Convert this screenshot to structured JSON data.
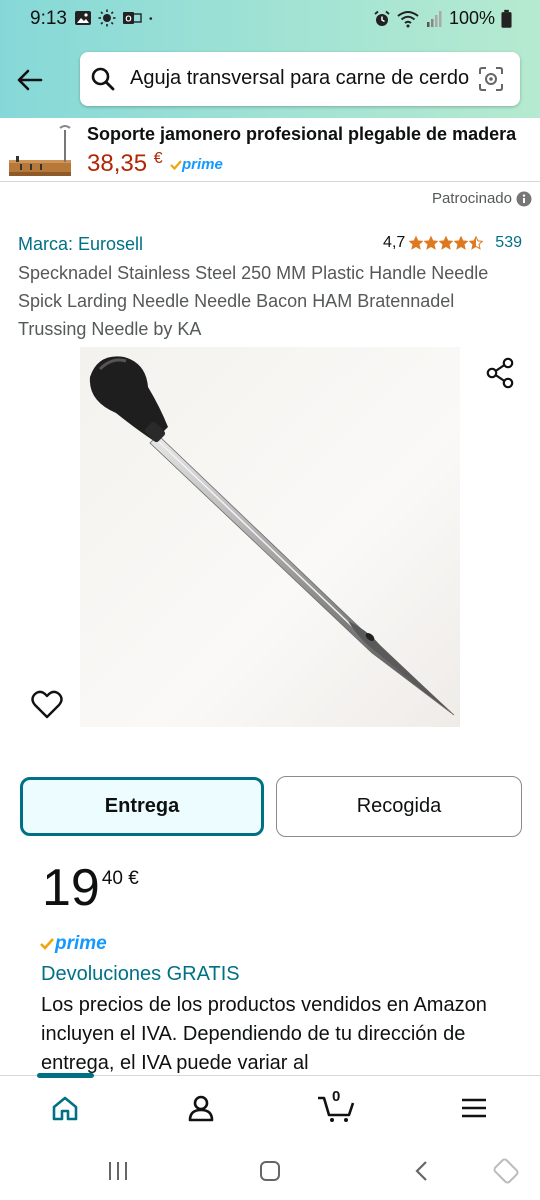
{
  "status_bar": {
    "time": "9:13",
    "battery": "100%"
  },
  "search": {
    "query": "Aguja transversal para carne de cerdo"
  },
  "sponsored_banner": {
    "title": "Soporte jamonero profesional plegable de madera",
    "price": "38,35",
    "currency": "€",
    "prime": "prime"
  },
  "patrocinado_label": "Patrocinado",
  "product": {
    "brand": "Marca: Eurosell",
    "rating_value": "4,7",
    "rating_stars": 4.5,
    "rating_count": "539",
    "title": "Specknadel Stainless Steel 250 MM Plastic Handle Needle Spick Larding Needle Needle Bacon HAM Bratennadel Trussing Needle by KA"
  },
  "delivery_toggle": {
    "entrega": "Entrega",
    "recogida": "Recogida"
  },
  "price": {
    "whole": "19",
    "fraction": "40 €"
  },
  "prime_label": "prime",
  "returns": "Devoluciones GRATIS",
  "vat_notice": "Los precios de los productos vendidos en Amazon incluyen el IVA. Dependiendo de tu dirección de entrega, el IVA puede variar al",
  "bottom_nav": {
    "cart_count": "0"
  },
  "colors": {
    "link": "#007185",
    "price_red": "#b12704",
    "prime_blue": "#1399ff",
    "star": "#de7921"
  }
}
